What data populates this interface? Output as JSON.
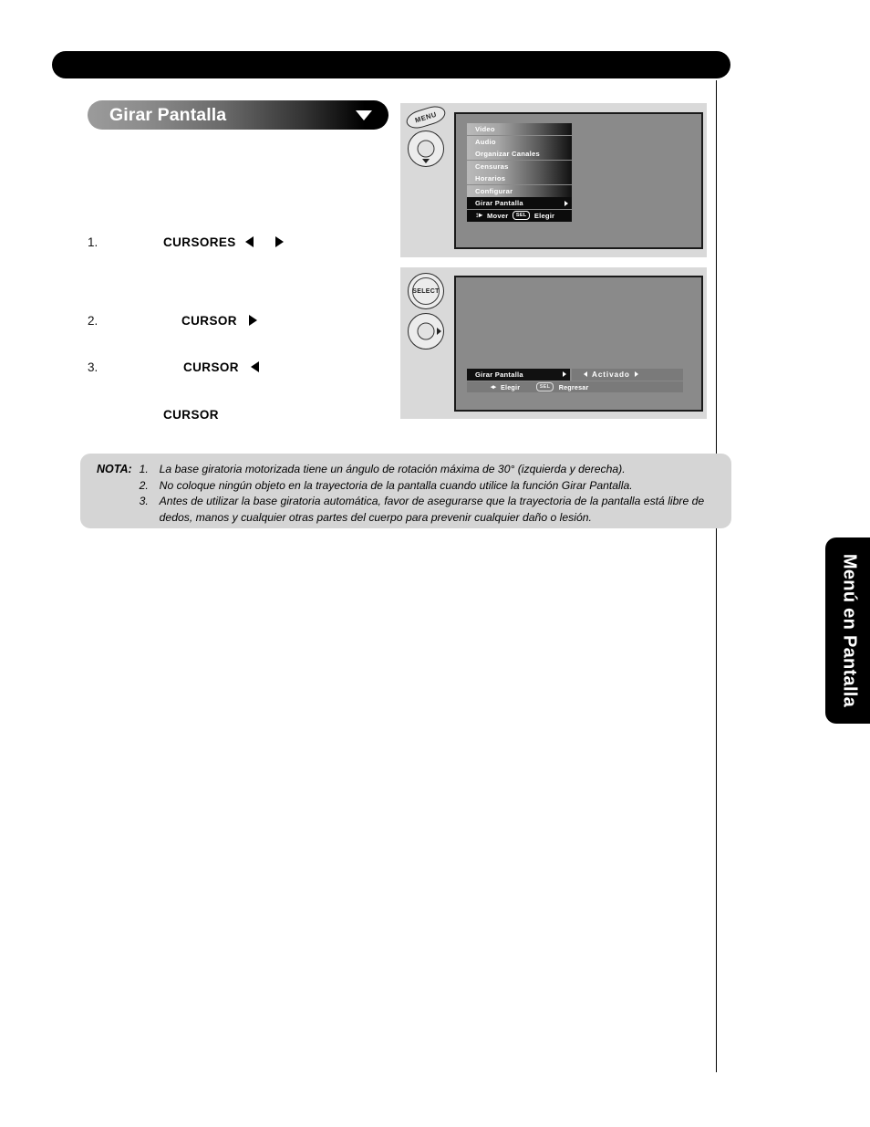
{
  "page": {
    "section_title": "Girar Pantalla",
    "side_tab_label": "Menú en Pantalla"
  },
  "steps": [
    {
      "num": "1.",
      "keyword": "CURSORES",
      "arrows": "left-right"
    },
    {
      "num": "2.",
      "keyword": "CURSOR",
      "arrows": "right"
    },
    {
      "num": "3.",
      "keyword": "CURSOR",
      "arrows": "left"
    },
    {
      "num": "",
      "keyword": "CURSOR",
      "arrows": "none"
    }
  ],
  "panel1": {
    "menu_key_label": "MENU",
    "osd_items": [
      {
        "label": "Video",
        "selected": false,
        "arrow": false
      },
      {
        "label": "Audio",
        "selected": false,
        "arrow": false
      },
      {
        "label": "Organizar Canales",
        "selected": false,
        "arrow": false
      },
      {
        "label": "Censuras",
        "selected": false,
        "arrow": false
      },
      {
        "label": "Horarios",
        "selected": false,
        "arrow": false
      },
      {
        "label": "Configurar",
        "selected": false,
        "arrow": false
      },
      {
        "label": "Girar Pantalla",
        "selected": true,
        "arrow": true
      }
    ],
    "help_move": "Mover",
    "help_sel_chip": "SEL",
    "help_choose": "Elegir"
  },
  "panel2": {
    "select_key_label": "SELECT",
    "setting_name": "Girar Pantalla",
    "setting_value": "Activado",
    "help_choose": "Elegir",
    "help_sel_chip": "SEL",
    "help_back": "Regresar"
  },
  "nota": {
    "label": "NOTA:",
    "items": [
      {
        "num": "1.",
        "text": "La base giratoria motorizada tiene un ángulo de rotación máxima de 30° (izquierda y derecha)."
      },
      {
        "num": "2.",
        "text": "No coloque ningún objeto en la trayectoria de la pantalla cuando utilice la función Girar Pantalla."
      },
      {
        "num": "3.",
        "text": "Antes de utilizar la base giratoria automática, favor de asegurarse que la trayectoria de la pantalla está libre de dedos, manos y cualquier otras partes del cuerpo para prevenir cualquier daño o lesión."
      }
    ]
  },
  "colors": {
    "bar_black": "#000000",
    "osd_screen": "#8a8a8a",
    "panel_bg": "#d9d9d9",
    "nota_bg": "#d5d5d5"
  }
}
